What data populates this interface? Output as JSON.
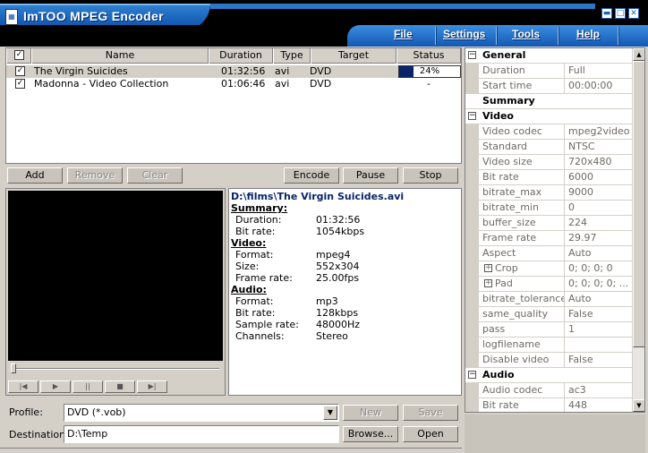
{
  "app": {
    "title": "ImTOO MPEG Encoder",
    "icon": "app-logo-icon"
  },
  "window_buttons": {
    "minimize": "▬",
    "maximize": "□",
    "close": "✕"
  },
  "menu": [
    {
      "label": "File"
    },
    {
      "label": "Settings"
    },
    {
      "label": "Tools"
    },
    {
      "label": "Help"
    }
  ],
  "file_table": {
    "columns": [
      "Name",
      "Duration",
      "Type",
      "Target",
      "Status"
    ],
    "header_checkbox": "✓",
    "rows": [
      {
        "checked": "✓",
        "name": "The Virgin Suicides",
        "duration": "01:32:56",
        "type": "avi",
        "target": "DVD",
        "status_percent": 24,
        "status_text": "24%"
      },
      {
        "checked": "✓",
        "name": "Madonna - Video Collection",
        "duration": "01:06:46",
        "type": "avi",
        "target": "DVD",
        "status_text": "-"
      }
    ]
  },
  "actions": {
    "add": "Add",
    "remove": "Remove",
    "clear": "Clear",
    "encode": "Encode",
    "pause": "Pause",
    "stop": "Stop"
  },
  "player_controls": [
    "|◀",
    "▶",
    "||",
    "■",
    "▶|"
  ],
  "info": {
    "path": "D:\\films\\The Virgin Suicides.avi",
    "summary_head": "Summary:",
    "summary": [
      {
        "k": "Duration:",
        "v": "01:32:56"
      },
      {
        "k": "Bit rate:",
        "v": "1054kbps"
      }
    ],
    "video_head": "Video:",
    "video": [
      {
        "k": "Format:",
        "v": "mpeg4"
      },
      {
        "k": "Size:",
        "v": "552x304"
      },
      {
        "k": "Frame rate:",
        "v": "25.00fps"
      }
    ],
    "audio_head": "Audio:",
    "audio": [
      {
        "k": "Format:",
        "v": "mp3"
      },
      {
        "k": "Bit rate:",
        "v": "128kbps"
      },
      {
        "k": "Sample rate:",
        "v": "48000Hz"
      },
      {
        "k": "Channels:",
        "v": "Stereo"
      }
    ]
  },
  "profile": {
    "label": "Profile:",
    "value": "DVD  (*.vob)",
    "new": "New",
    "save": "Save"
  },
  "destination": {
    "label": "Destination:",
    "value": "D:\\Temp",
    "browse": "Browse...",
    "open": "Open"
  },
  "properties": [
    {
      "group": "General",
      "expander": "−"
    },
    {
      "k": "Duration",
      "v": "Full"
    },
    {
      "k": "Start time",
      "v": "00:00:00"
    },
    {
      "subgroup": "Summary"
    },
    {
      "group": "Video",
      "expander": "−"
    },
    {
      "k": "Video codec",
      "v": "mpeg2video"
    },
    {
      "k": "Standard",
      "v": "NTSC"
    },
    {
      "k": "Video size",
      "v": "720x480"
    },
    {
      "k": "Bit rate",
      "v": "6000"
    },
    {
      "k": "bitrate_max",
      "v": "9000"
    },
    {
      "k": "bitrate_min",
      "v": "0"
    },
    {
      "k": "buffer_size",
      "v": "224"
    },
    {
      "k": "Frame rate",
      "v": "29.97"
    },
    {
      "k": "Aspect",
      "v": "Auto"
    },
    {
      "k": "Crop",
      "v": "0; 0; 0; 0",
      "expander": "+"
    },
    {
      "k": "Pad",
      "v": "0; 0; 0; 0; ...",
      "expander": "+"
    },
    {
      "k": "bitrate_tolerance",
      "v": "Auto"
    },
    {
      "k": "same_quality",
      "v": "False"
    },
    {
      "k": "pass",
      "v": "1"
    },
    {
      "k": "logfilename",
      "v": ""
    },
    {
      "k": "Disable video",
      "v": "False"
    },
    {
      "group": "Audio",
      "expander": "−"
    },
    {
      "k": "Audio codec",
      "v": "ac3"
    },
    {
      "k": "Bit rate",
      "v": "448"
    }
  ],
  "scroll": {
    "up": "▲",
    "down": "▼"
  }
}
